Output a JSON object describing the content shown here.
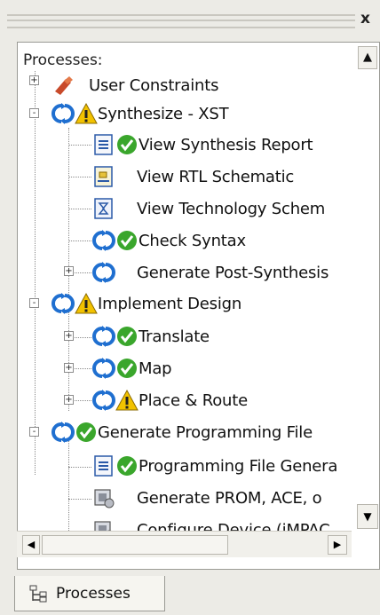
{
  "window": {
    "close_glyph": "x"
  },
  "panel": {
    "header": "Processes:"
  },
  "tree": {
    "items": [
      {
        "label": "User Constraints",
        "icons": [
          "constraints-icon"
        ],
        "expander": "+"
      },
      {
        "label": "Synthesize - XST",
        "icons": [
          "refresh-icon",
          "warning-icon"
        ],
        "expander": "-"
      },
      {
        "label": "View Synthesis Report",
        "icons": [
          "report-icon",
          "check-icon"
        ]
      },
      {
        "label": "View RTL Schematic",
        "icons": [
          "schematic-icon"
        ]
      },
      {
        "label": "View Technology Schem",
        "icons": [
          "schematic-icon"
        ]
      },
      {
        "label": "Check Syntax",
        "icons": [
          "refresh-icon",
          "check-icon"
        ]
      },
      {
        "label": "Generate Post-Synthesis",
        "icons": [
          "refresh-icon"
        ],
        "expander": "+"
      },
      {
        "label": "Implement Design",
        "icons": [
          "refresh-icon",
          "warning-icon"
        ],
        "expander": "-"
      },
      {
        "label": "Translate",
        "icons": [
          "refresh-icon",
          "check-icon"
        ],
        "expander": "+"
      },
      {
        "label": "Map",
        "icons": [
          "refresh-icon",
          "check-icon"
        ],
        "expander": "+"
      },
      {
        "label": "Place & Route",
        "icons": [
          "refresh-icon",
          "warning-icon"
        ],
        "expander": "+"
      },
      {
        "label": "Generate Programming File",
        "icons": [
          "refresh-icon",
          "check-icon"
        ],
        "expander": "-"
      },
      {
        "label": "Programming File Genera",
        "icons": [
          "report-icon",
          "check-icon"
        ]
      },
      {
        "label": "Generate PROM, ACE, o",
        "icons": [
          "device-icon"
        ]
      },
      {
        "label": "Configure Device (iMPAC",
        "icons": [
          "device-icon"
        ]
      }
    ]
  },
  "tabs": [
    {
      "label": "Processes",
      "icon": "processes-tab-icon"
    }
  ],
  "colors": {
    "accent_blue": "#1f6fd0",
    "check_green": "#3aa62c",
    "warning_yellow": "#f2c200"
  }
}
